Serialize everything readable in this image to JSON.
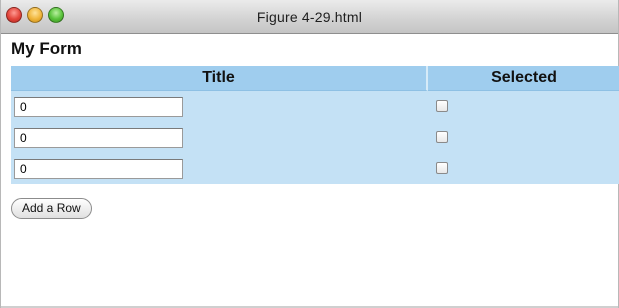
{
  "window": {
    "title": "Figure 4-29.html"
  },
  "form": {
    "heading": "My Form",
    "columns": {
      "title": "Title",
      "selected": "Selected"
    },
    "rows": [
      {
        "title_value": "0",
        "selected": false
      },
      {
        "title_value": "0",
        "selected": false
      },
      {
        "title_value": "0",
        "selected": false
      }
    ],
    "add_row_label": "Add a Row"
  },
  "colors": {
    "header_background": "#9fcdee",
    "row_background": "#c4e1f5"
  }
}
